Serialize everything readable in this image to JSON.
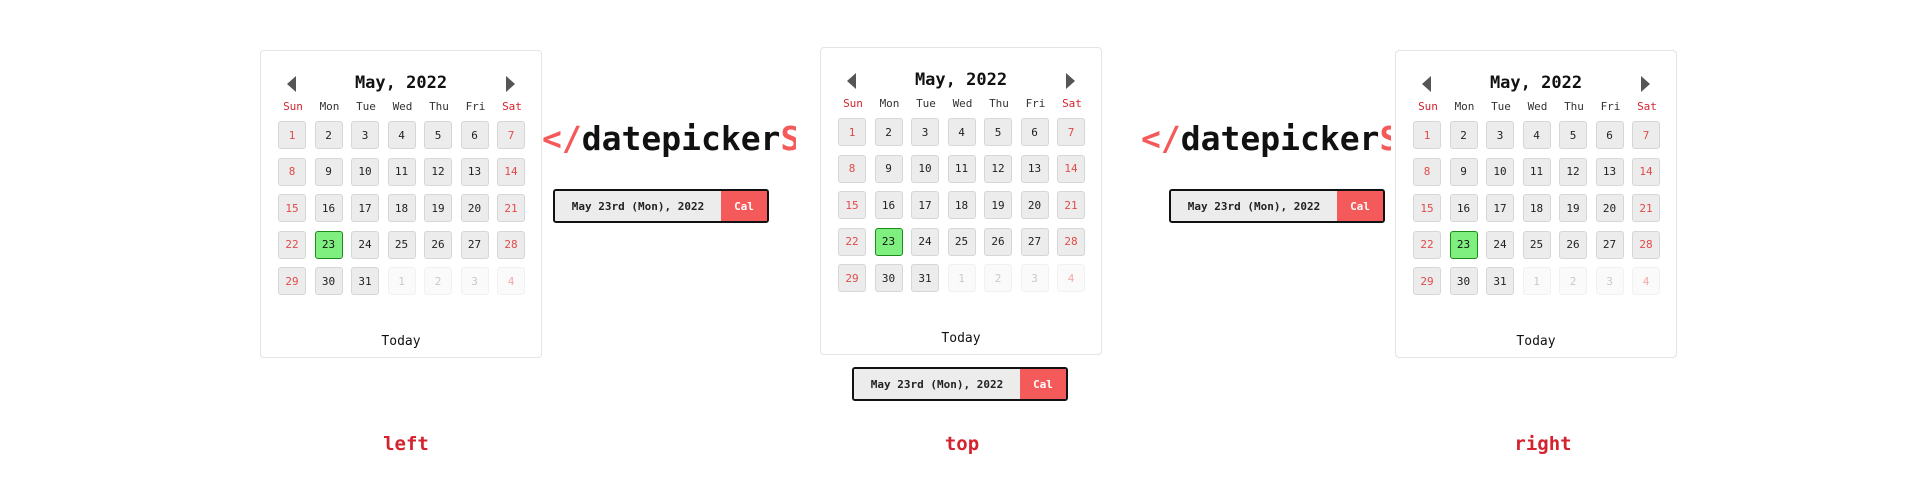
{
  "calendar": {
    "month_title": "May, 2022",
    "weekdays": [
      "Sun",
      "Mon",
      "Tue",
      "Wed",
      "Thu",
      "Fri",
      "Sat"
    ],
    "weeks": [
      [
        "1",
        "2",
        "3",
        "4",
        "5",
        "6",
        "7"
      ],
      [
        "8",
        "9",
        "10",
        "11",
        "12",
        "13",
        "14"
      ],
      [
        "15",
        "16",
        "17",
        "18",
        "19",
        "20",
        "21"
      ],
      [
        "22",
        "23",
        "24",
        "25",
        "26",
        "27",
        "28"
      ],
      [
        "29",
        "30",
        "31",
        "1",
        "2",
        "3",
        "4"
      ]
    ],
    "selected_day": "23",
    "today_label": "Today"
  },
  "logo": {
    "slash": "</",
    "word": "datepicker",
    "suffix": "S>"
  },
  "field": {
    "value": "May 23rd (Mon), 2022",
    "button_label": "Cal"
  },
  "positions": {
    "left": "left",
    "top": "top",
    "right": "right"
  },
  "colors": {
    "accent": "#f55a5a",
    "weekend": "#d4232e",
    "selected": "#7ff07f"
  }
}
